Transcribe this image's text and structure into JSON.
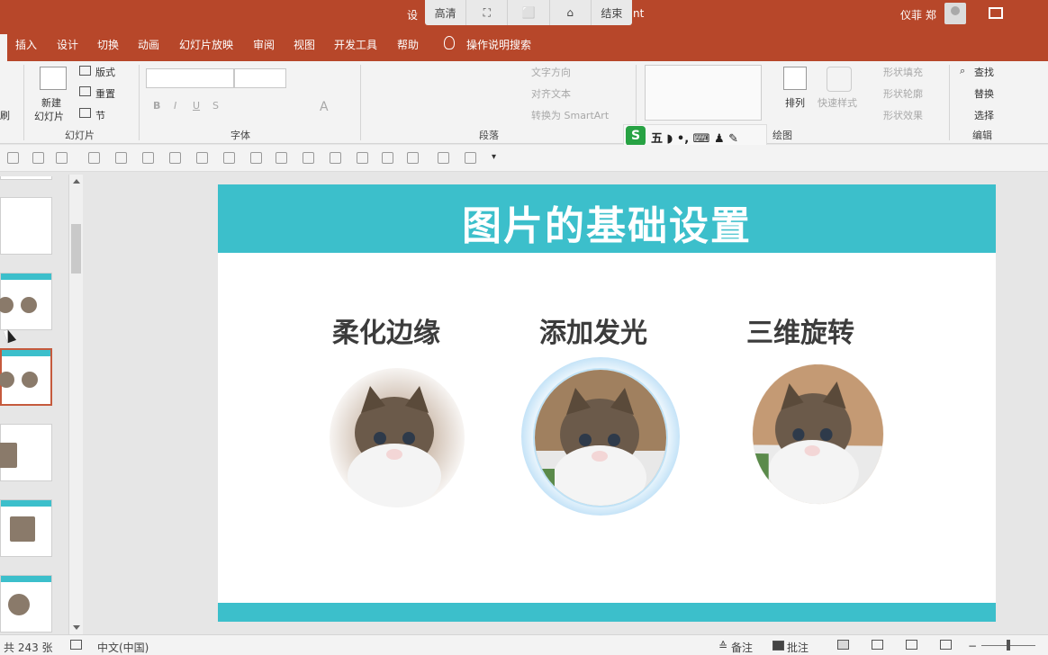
{
  "titlebar": {
    "title_left": "设",
    "title_right": "nt",
    "user": "仪菲 郑"
  },
  "video_controls": [
    "高清",
    "⛶",
    "⬜",
    "⌂",
    "结束"
  ],
  "tabs": [
    "插入",
    "设计",
    "切换",
    "动画",
    "幻灯片放映",
    "审阅",
    "视图",
    "开发工具",
    "帮助"
  ],
  "search_label": "操作说明搜索",
  "ribbon": {
    "slides_group": {
      "label": "幻灯片",
      "new_slide": "新建",
      "new_slide2": "幻灯片",
      "layout": "版式",
      "reset": "重置",
      "section": "节"
    },
    "font_group": {
      "label": "字体"
    },
    "paragraph_group": {
      "label": "段落",
      "text_direction": "文字方向",
      "align_text": "对齐文本",
      "smartart": "转换为 SmartArt"
    },
    "drawing_group": {
      "label": "绘图",
      "arrange": "排列",
      "quick_styles": "快速样式",
      "fill": "形状填充",
      "outline": "形状轮廓",
      "effects": "形状效果"
    },
    "editing_group": {
      "label": "编辑",
      "find": "查找",
      "replace": "替换",
      "select": "选择"
    },
    "clipboard_partial": "刷"
  },
  "ime": {
    "logo": "S",
    "text": "五 ◗ •, ⌨ ♟ ✎"
  },
  "slide": {
    "title": "图片的基础设置",
    "items": [
      {
        "label": "柔化边缘"
      },
      {
        "label": "添加发光"
      },
      {
        "label": "三维旋转"
      }
    ]
  },
  "status": {
    "slide_count": "共 243 张",
    "language": "中文(中国)",
    "notes": "备注",
    "comments": "批注"
  },
  "colors": {
    "accent": "#b7472a",
    "teal": "#3cbfcb"
  }
}
